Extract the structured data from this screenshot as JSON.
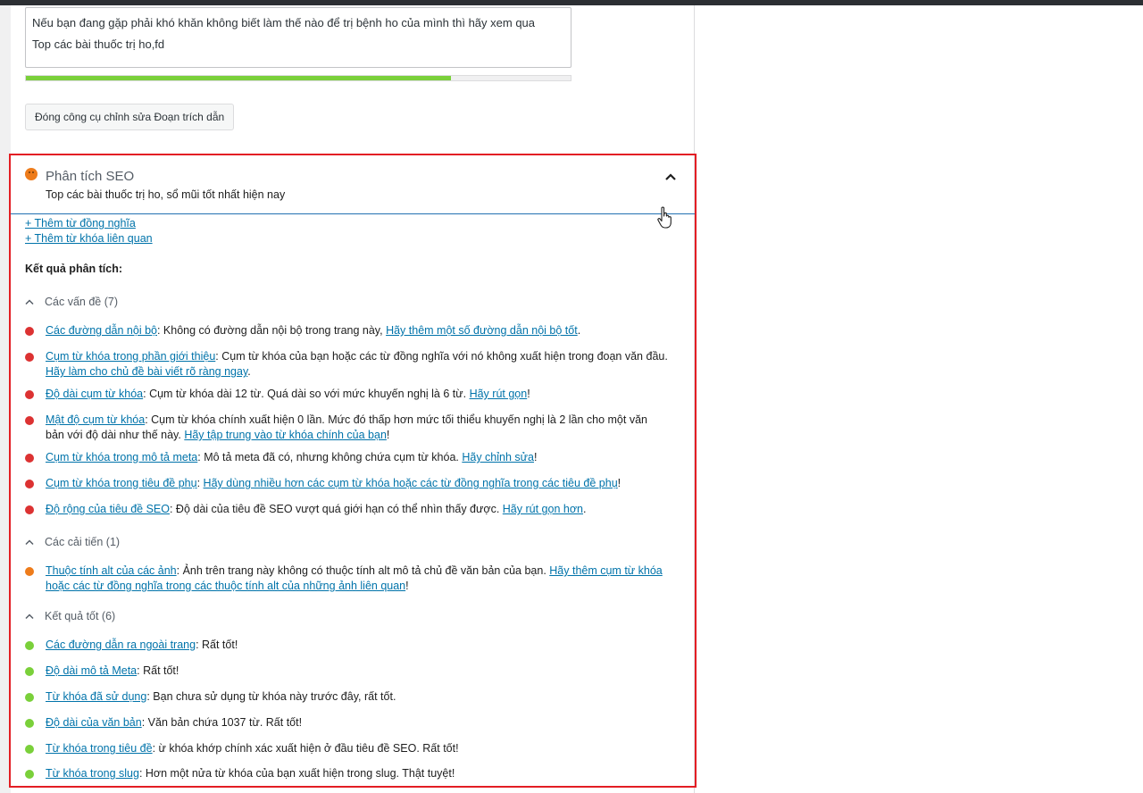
{
  "excerpt": {
    "line1": "Nếu bạn đang gặp phải khó khăn không biết làm thế nào để trị bệnh ho của mình thì hãy xem qua",
    "line2": "Top các bài thuốc trị ho,fd",
    "progress_percent": 78,
    "progress_color": "#7ad03a"
  },
  "close_editor_button": "Đóng công cụ chỉnh sửa Đoạn trích dẫn",
  "seo_analysis": {
    "title": "Phân tích SEO",
    "keyphrase": "Top các bài thuốc trị ho, sổ mũi tốt nhất hiện nay",
    "score_icon": "orange-smiley-icon",
    "add_synonyms": "+ Thêm từ đồng nghĩa",
    "add_related": "+ Thêm từ khóa liên quan",
    "results_heading": "Kết quả phân tích:",
    "highlight_color": "#e31e24"
  },
  "problems": {
    "heading": "Các vấn đề (7)",
    "bullet_color": "#dc3232",
    "items": [
      {
        "link": "Các đường dẫn nội bộ",
        "text": ": Không có đường dẫn nội bộ trong trang này, ",
        "action": "Hãy thêm một số đường dẫn nội bộ tốt",
        "end": "."
      },
      {
        "link": "Cụm từ khóa trong phần giới thiệu",
        "text": ": Cụm từ khóa của bạn hoặc các từ đồng nghĩa với nó không xuất hiện trong đoạn văn đầu. ",
        "action": "Hãy làm cho chủ đề bài viết rõ ràng ngay",
        "end": "."
      },
      {
        "link": "Độ dài cụm từ khóa",
        "text": ": Cụm từ khóa dài 12 từ. Quá dài so với mức khuyến nghị là 6 từ. ",
        "action": "Hãy rút gọn",
        "end": "!"
      },
      {
        "link": "Mật độ cụm từ khóa",
        "text": ": Cụm từ khóa chính xuất hiện 0 lần. Mức đó thấp hơn mức tối thiểu khuyến nghị là 2 lần cho một văn bản với độ dài như thế này. ",
        "action": "Hãy tập trung vào từ khóa chính của bạn",
        "end": "!"
      },
      {
        "link": "Cụm từ khóa trong mô tả meta",
        "text": ": Mô tả meta đã có, nhưng không chứa cụm từ khóa. ",
        "action": "Hãy chỉnh sửa",
        "end": "!"
      },
      {
        "link": "Cụm từ khóa trong tiêu đề phụ",
        "text": ": ",
        "action": "Hãy dùng nhiều hơn các cụm từ khóa hoặc các từ đồng nghĩa trong các tiêu đề phụ",
        "end": "!"
      },
      {
        "link": "Độ rộng của tiêu đề SEO",
        "text": ": Độ dài của tiêu đề SEO vượt quá giới hạn có thể nhìn thấy được. ",
        "action": "Hãy rút gọn hơn",
        "end": "."
      }
    ]
  },
  "improvements": {
    "heading": "Các cải tiến (1)",
    "bullet_color": "#ee7c1b",
    "items": [
      {
        "link": "Thuộc tính alt của các ảnh",
        "text": ": Ảnh trên trang này không có thuộc tính alt mô tả chủ đề văn bản của bạn. ",
        "action": "Hãy thêm cụm từ khóa hoặc các từ đồng nghĩa trong các thuộc tính alt của những ảnh liên quan",
        "end": "!"
      }
    ]
  },
  "good_results": {
    "heading": "Kết quả tốt (6)",
    "bullet_color": "#7ad03a",
    "items": [
      {
        "link": "Các đường dẫn ra ngoài trang",
        "text": ": Rất tốt!"
      },
      {
        "link": "Độ dài mô tả Meta",
        "text": ": Rất tốt!"
      },
      {
        "link": "Từ khóa đã sử dụng",
        "text": ": Bạn chưa sử dụng từ khóa này trước đây, rất tốt."
      },
      {
        "link": "Độ dài của văn bản",
        "text": ": Văn bản chứa 1037 từ. Rất tốt!"
      },
      {
        "link": "Từ khóa trong tiêu đề",
        "text": ": ừ khóa khớp chính xác xuất hiện ở đầu tiêu đề SEO. Rất tốt!"
      },
      {
        "link": "Từ khóa trong slug",
        "text": ": Hơn một nửa từ khóa của bạn xuất hiện trong slug. Thật tuyệt!"
      }
    ]
  }
}
